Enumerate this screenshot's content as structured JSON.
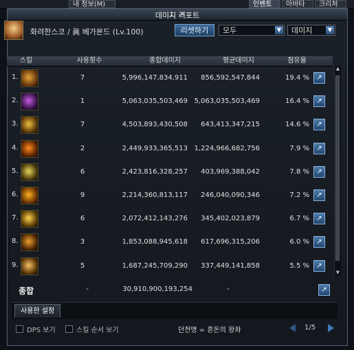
{
  "background_tabs": [
    "내 정보(M)",
    "인벤토리",
    "아바타",
    "크리쳐"
  ],
  "window": {
    "title": "데미지 리포트"
  },
  "character": {
    "name": "화려한스코 / 眞 베가본드 (Lv.100)"
  },
  "controls": {
    "reset_label": "리셋하기",
    "filter1": "모두",
    "filter2": "데미지"
  },
  "table": {
    "headers": {
      "skill": "스킬",
      "uses": "사용횟수",
      "total": "종합데미지",
      "avg": "평균데미지",
      "share": "점유율"
    },
    "rows": [
      {
        "rank": "1.",
        "uses": "7",
        "total": "5,996,147,834,911",
        "avg": "856,592,547,844",
        "share": "19.4 %"
      },
      {
        "rank": "2.",
        "uses": "1",
        "total": "5,063,035,503,469",
        "avg": "5,063,035,503,469",
        "share": "16.4 %"
      },
      {
        "rank": "3.",
        "uses": "7",
        "total": "4,503,893,430,508",
        "avg": "643,413,347,215",
        "share": "14.6 %"
      },
      {
        "rank": "4.",
        "uses": "2",
        "total": "2,449,933,365,513",
        "avg": "1,224,966,682,756",
        "share": "7.9 %"
      },
      {
        "rank": "5.",
        "uses": "6",
        "total": "2,423,816,328,257",
        "avg": "403,969,388,042",
        "share": "7.8 %"
      },
      {
        "rank": "6.",
        "uses": "9",
        "total": "2,214,360,813,117",
        "avg": "246,040,090,346",
        "share": "7.2 %"
      },
      {
        "rank": "7.",
        "uses": "6",
        "total": "2,072,412,143,276",
        "avg": "345,402,023,879",
        "share": "6.7 %"
      },
      {
        "rank": "8.",
        "uses": "3",
        "total": "1,853,088,945,618",
        "avg": "617,696,315,206",
        "share": "6.0 %"
      },
      {
        "rank": "9.",
        "uses": "5",
        "total": "1,687,245,709,290",
        "avg": "337,449,141,858",
        "share": "5.5 %"
      }
    ]
  },
  "summary": {
    "label": "총합",
    "uses": "-",
    "total": "30,910,900,193,254",
    "avg": "-"
  },
  "tabs": {
    "settings": "사용한 설정"
  },
  "footer": {
    "dps_label": "DPS 보기",
    "order_label": "스킬 순서 보기",
    "party_label": "던전명 = 혼돈의 왕좌",
    "page": "1/5"
  },
  "colors": {
    "accent": "#3e6d9c",
    "share_btn": "#4c7caa"
  }
}
